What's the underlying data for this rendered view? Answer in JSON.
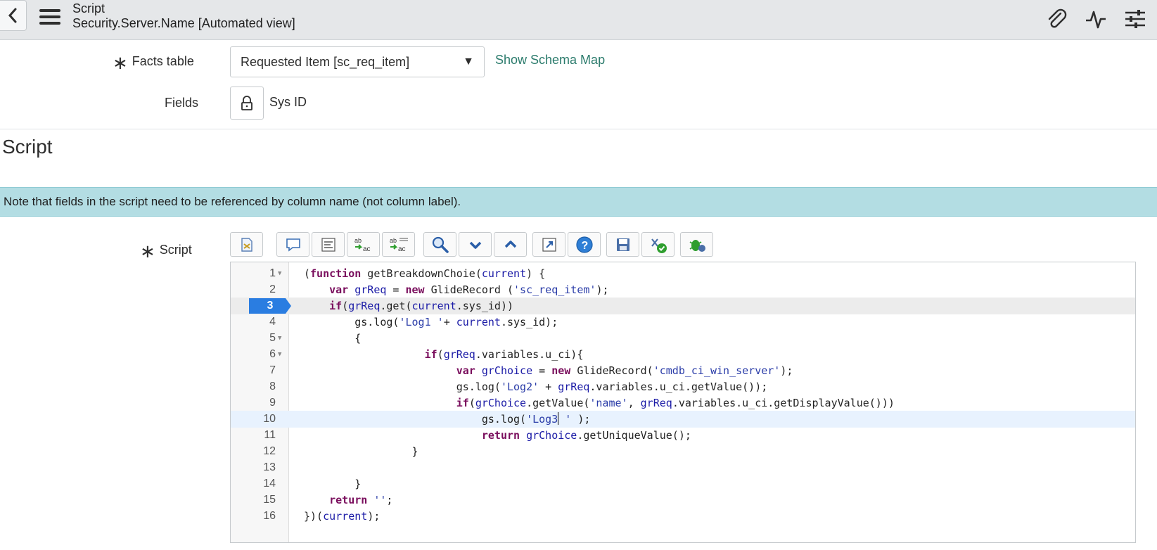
{
  "header": {
    "title": "Script",
    "subtitle": "Security.Server.Name [Automated view]",
    "icons": [
      "back-icon",
      "menu-icon",
      "paperclip-icon",
      "activity-icon",
      "settings-sliders-icon"
    ]
  },
  "form": {
    "facts_table": {
      "label": "Facts table",
      "required_marker": "∗",
      "value": "Requested Item [sc_req_item]",
      "link": "Show Schema Map"
    },
    "fields": {
      "label": "Fields",
      "value": "Sys ID"
    }
  },
  "section": {
    "title": "Script",
    "note": "Note that fields in the script need to be referenced by column name (not column label)."
  },
  "script_field": {
    "label": "Script",
    "required_marker": "∗",
    "toolbar": [
      "script-assistant-icon",
      "comment-icon",
      "format-icon",
      "replace-icon",
      "replace-all-icon",
      "search-icon",
      "find-next-icon",
      "find-previous-icon",
      "fullscreen-icon",
      "help-icon",
      "save-icon",
      "check-syntax-icon",
      "debug-icon"
    ],
    "active_line": 3,
    "cursor_line": 10,
    "lines": [
      {
        "n": "1",
        "fold": true,
        "text": "(function getBreakdownChoie(current) {"
      },
      {
        "n": "2",
        "fold": false,
        "text": "    var grReq = new GlideRecord ('sc_req_item');"
      },
      {
        "n": "3",
        "fold": false,
        "text": "    if(grReq.get(current.sys_id))"
      },
      {
        "n": "4",
        "fold": false,
        "text": "        gs.log('Log1 '+ current.sys_id);"
      },
      {
        "n": "5",
        "fold": true,
        "text": "        {"
      },
      {
        "n": "6",
        "fold": true,
        "text": "                   if(grReq.variables.u_ci){"
      },
      {
        "n": "7",
        "fold": false,
        "text": "                        var grChoice = new GlideRecord('cmdb_ci_win_server');"
      },
      {
        "n": "8",
        "fold": false,
        "text": "                        gs.log('Log2' + grReq.variables.u_ci.getValue());"
      },
      {
        "n": "9",
        "fold": false,
        "text": "                        if(grChoice.getValue('name', grReq.variables.u_ci.getDisplayValue()))"
      },
      {
        "n": "10",
        "fold": false,
        "text": "                            gs.log('Log3 ' );"
      },
      {
        "n": "11",
        "fold": false,
        "text": "                            return grChoice.getUniqueValue();"
      },
      {
        "n": "12",
        "fold": false,
        "text": "                 }"
      },
      {
        "n": "13",
        "fold": false,
        "text": ""
      },
      {
        "n": "14",
        "fold": false,
        "text": "        }"
      },
      {
        "n": "15",
        "fold": false,
        "text": "    return '';"
      },
      {
        "n": "16",
        "fold": false,
        "text": "})(current);"
      }
    ]
  }
}
